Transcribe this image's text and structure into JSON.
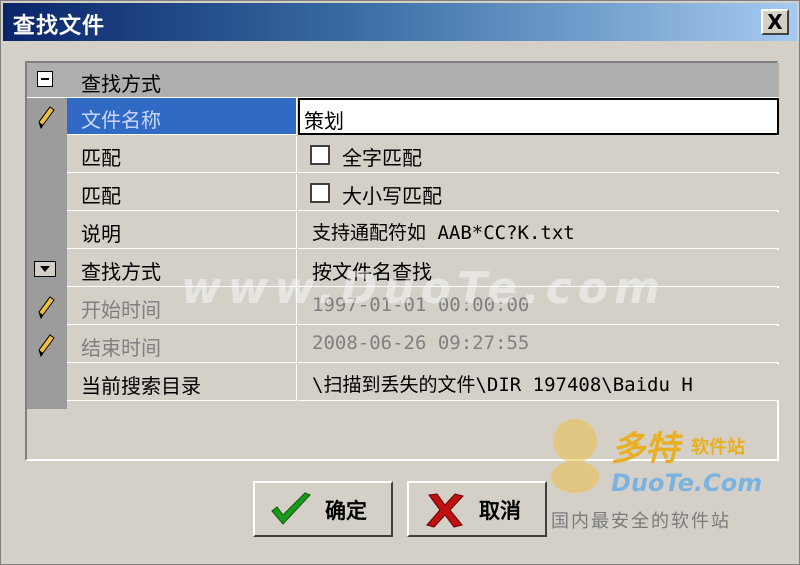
{
  "window": {
    "title": "查找文件",
    "close_glyph": "X"
  },
  "groups": [
    {
      "label": "查找方式"
    }
  ],
  "rows": [
    {
      "name": "文件名称",
      "value": "策划"
    },
    {
      "name": "匹配",
      "value": "全字匹配",
      "checked": false
    },
    {
      "name": "匹配",
      "value": "大小写匹配",
      "checked": false
    },
    {
      "name": "说明",
      "value": "支持通配符如 AAB*CC?K.txt"
    },
    {
      "name": "查找方式",
      "value": "按文件名查找"
    },
    {
      "name": "开始时间",
      "value": "1997-01-01 00:00:00"
    },
    {
      "name": "结束时间",
      "value": "2008-06-26 09:27:55"
    },
    {
      "name": "当前搜索目录",
      "value": "\\扫描到丢失的文件\\DIR 197408\\Baidu H"
    }
  ],
  "buttons": {
    "ok": "确定",
    "cancel": "取消"
  },
  "watermark": {
    "text": "www.DuoTe.com"
  },
  "logo": {
    "brand": "多特",
    "brand_sub": "软件站",
    "site": "DuoTe.Com",
    "slogan": "国内最安全的软件站"
  },
  "colors": {
    "title_start": "#0a246a",
    "title_end": "#a6caf0",
    "selection": "#316ac5",
    "ok_check": "#1a9a1a",
    "cancel_x": "#c01010"
  }
}
